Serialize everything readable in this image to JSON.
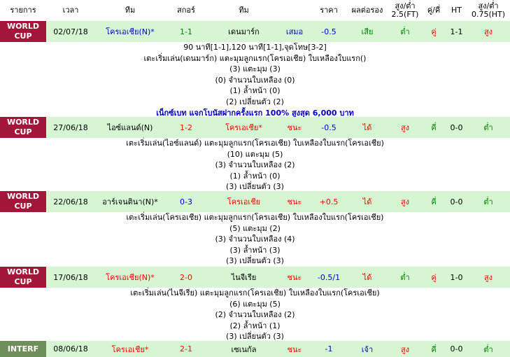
{
  "header": [
    "รายการ",
    "เวลา",
    "ทีม",
    "สกอร์",
    "ทีม",
    "ราคา",
    "ผลต่อรอง",
    "สูง/ต่ำ 2.5(FT)",
    "คู่/คี่",
    "HT",
    "สูง/ต่ำ 0.75(HT)"
  ],
  "matches": [
    {
      "comp": "WORLD CUP",
      "date": "02/07/18",
      "home": "โครเอเชีย(N)*",
      "score": "1-1",
      "away": "เดนมาร์ก",
      "result": "เสมอ",
      "odds": "-0.5",
      "handicap": "เสีย",
      "ou": "ต่ำ",
      "oe": "คู่",
      "ht": "1-1",
      "ou_ht": "สูง",
      "details": [
        "90 นาที[1-1],120 นาที[1-1],จุดโทษ[3-2]",
        "เตะเริ่มเล่น(เดนมาร์ก)  แตะมุมลูกแรก(โครเอเชีย)  ใบเหลืองใบแรก()",
        "(3) แตะมุม (3)",
        "(0) จำนวนใบเหลือง (0)",
        "(1) ล้ำหน้า (0)",
        "(2) เปลี่ยนตัว (2)"
      ],
      "promo": "เน็กซ์เบท แจกโบนัสฝากครั้งแรก 100% สูงสุด 6,000 บาท"
    },
    {
      "comp": "WORLD CUP",
      "date": "27/06/18",
      "home": "ไอซ์แลนด์(N)",
      "score": "1-2",
      "away": "โครเอเชีย*",
      "result": "ชนะ",
      "odds": "-0.5",
      "handicap": "ได้",
      "ou": "สูง",
      "oe": "คี่",
      "ht": "0-0",
      "ou_ht": "ต่ำ",
      "details": [
        "เตะเริ่มเล่น(ไอซ์แลนด์)  แตะมุมลูกแรก(โครเอเชีย)  ใบเหลืองใบแรก(โครเอเชีย)",
        "(10) แตะมุม (5)",
        "(3) จำนวนใบเหลือง (2)",
        "(1) ล้ำหน้า (0)",
        "(3) เปลี่ยนตัว (3)"
      ]
    },
    {
      "comp": "WORLD CUP",
      "date": "22/06/18",
      "home": "อาร์เจนตินา(N)*",
      "score": "0-3",
      "away": "โครเอเชีย",
      "result": "ชนะ",
      "odds": "+0.5",
      "handicap": "ได้",
      "ou": "สูง",
      "oe": "คี่",
      "ht": "0-0",
      "ou_ht": "ต่ำ",
      "details": [
        "เตะเริ่มเล่น(โครเอเชีย)  แตะมุมลูกแรก(โครเอเชีย)  ใบเหลืองใบแรก(โครเอเชีย)",
        "(5) แตะมุม (2)",
        "(3) จำนวนใบเหลือง (4)",
        "(3) ล้ำหน้า (3)",
        "(3) เปลี่ยนตัว (3)"
      ]
    },
    {
      "comp": "WORLD CUP",
      "date": "17/06/18",
      "home": "โครเอเชีย(N)*",
      "score": "2-0",
      "away": "ไนจีเรีย",
      "result": "ชนะ",
      "odds": "-0.5/1",
      "handicap": "ได้",
      "ou": "ต่ำ",
      "oe": "คู่",
      "ht": "1-0",
      "ou_ht": "สูง",
      "details": [
        "เตะเริ่มเล่น(ไนจีเรีย)  แตะมุมลูกแรก(โครเอเชีย)  ใบเหลืองใบแรก(โครเอเชีย)",
        "(6) แตะมุม (5)",
        "(2) จำนวนใบเหลือง (2)",
        "(2) ล้ำหน้า (1)",
        "(3) เปลี่ยนตัว (3)"
      ]
    },
    {
      "comp": "INTERF",
      "date": "08/06/18",
      "home": "โครเอเชีย*",
      "score": "2-1",
      "away": "เซเนกัล",
      "result": "ชนะ",
      "odds": "-1",
      "handicap": "เจ้า",
      "ou": "สูง",
      "oe": "คี่",
      "ht": "0-0",
      "ou_ht": "ต่ำ",
      "details": []
    }
  ]
}
